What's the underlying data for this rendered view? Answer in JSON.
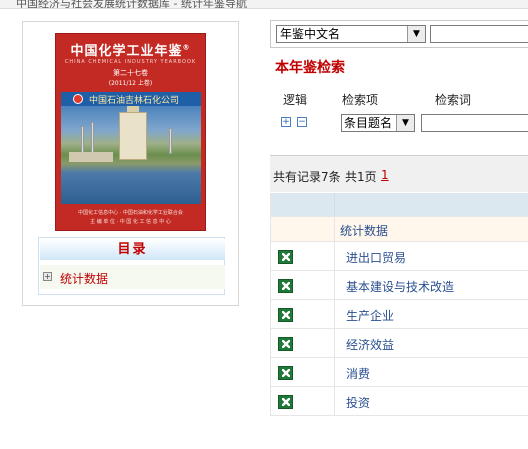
{
  "top": {
    "breadcrumb": "中国经济与社会发展统计数据库 - 统计年鉴导航"
  },
  "book": {
    "cover_title": "中国化学工业年鉴",
    "cover_mark": "®",
    "cover_en": "CHINA CHEMICAL INDUSTRY YEARBOOK",
    "cover_volume": "第二十七卷",
    "cover_year": "(2011/12 上卷)",
    "company": "中国石油吉林石化公司",
    "foot1": "中国化工信息中心 · 中国石油和化学工业联合会",
    "foot2": "主 编 单 位 · 中 国 化 工 信 息 中 心"
  },
  "toc": {
    "title": "目录",
    "items": [
      "统计数据"
    ]
  },
  "search": {
    "scope_selected": "年鉴中文名",
    "title": "本年鉴检索",
    "col_logic": "逻辑",
    "col_field": "检索项",
    "col_term": "检索词",
    "logic_add": "+",
    "logic_remove": "−",
    "field_selected": "条目题名"
  },
  "records": {
    "total_text": "共有记录7条",
    "pages_text": "共1页",
    "page_link": "1"
  },
  "table": {
    "category": "统计数据",
    "rows": [
      "进出口贸易",
      "基本建设与技术改造",
      "生产企业",
      "经济效益",
      "消费",
      "投资"
    ]
  },
  "colors": {
    "accent_red": "#c00000",
    "link_blue": "#2a4f8f",
    "header_blue": "#dbe8ef"
  }
}
